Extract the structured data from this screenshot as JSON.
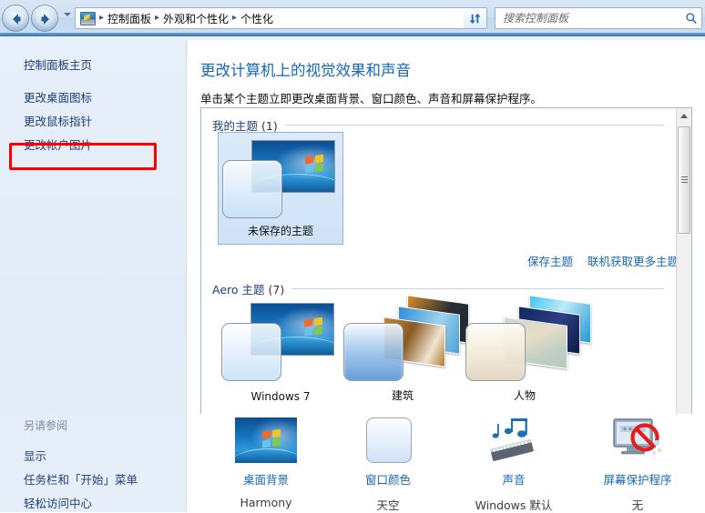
{
  "window": {
    "nav": {
      "back": "后退",
      "forward": "前进",
      "recent_pages": "最近浏览的位置"
    },
    "breadcrumb": {
      "icon": "personalization-monitor-icon",
      "items": [
        "控制面板",
        "外观和个性化",
        "个性化"
      ],
      "separator": "▸",
      "dropdown": "chevron-down-icon"
    },
    "refresh": {
      "icon": "refresh-icon",
      "tooltip": "刷新"
    },
    "search": {
      "placeholder": "搜索控制面板",
      "value": "",
      "icon": "search-icon"
    },
    "help": {
      "icon": "help-icon",
      "glyph": "?"
    }
  },
  "sidebar": {
    "home_label": "控制面板主页",
    "items": [
      {
        "label": "更改桌面图标",
        "highlighted": false
      },
      {
        "label": "更改鼠标指针",
        "highlighted": true
      },
      {
        "label": "更改帐户图片",
        "highlighted": false
      }
    ],
    "see_also_title": "另请参阅",
    "see_also": [
      {
        "label": "显示"
      },
      {
        "label": "任务栏和「开始」菜单"
      },
      {
        "label": "轻松访问中心"
      }
    ],
    "highlight_color": "#ff0000"
  },
  "main": {
    "heading": "更改计算机上的视觉效果和声音",
    "subheading": "单击某个主题立即更改桌面背景、窗口颜色、声音和屏幕保护程序。",
    "groups": [
      {
        "name": "我的主题",
        "count": "(1)",
        "themes": [
          {
            "label": "未保存的主题",
            "selected": true,
            "art": "windows7"
          }
        ]
      },
      {
        "name": "Aero 主题",
        "count": "(7)",
        "themes": [
          {
            "label": "Windows 7",
            "selected": false,
            "art": "windows7"
          },
          {
            "label": "建筑",
            "selected": false,
            "art": "architecture"
          },
          {
            "label": "人物",
            "selected": false,
            "art": "people"
          }
        ]
      }
    ],
    "links": [
      {
        "label": "保存主题"
      },
      {
        "label": "联机获取更多主题"
      }
    ],
    "scrollbar": {
      "up_icon": "scroll-up-icon",
      "down_icon": "scroll-down-icon",
      "grip": "scrollbar-grip"
    }
  },
  "bottom_bar": {
    "items": [
      {
        "label": "桌面背景",
        "value": "Harmony",
        "icon": "desktop-background-icon"
      },
      {
        "label": "窗口颜色",
        "value": "天空",
        "icon": "window-color-icon"
      },
      {
        "label": "声音",
        "value": "Windows 默认",
        "icon": "sound-icon"
      },
      {
        "label": "屏幕保护程序",
        "value": "无",
        "icon": "screensaver-icon"
      }
    ]
  },
  "colors": {
    "accent_link": "#1667b5",
    "heading": "#1667b5",
    "sidebar_bg": "#e4edf8",
    "sidebar_link": "#1f3f77",
    "highlight_box": "#ff0000",
    "panel_border": "#a9b6c6"
  }
}
